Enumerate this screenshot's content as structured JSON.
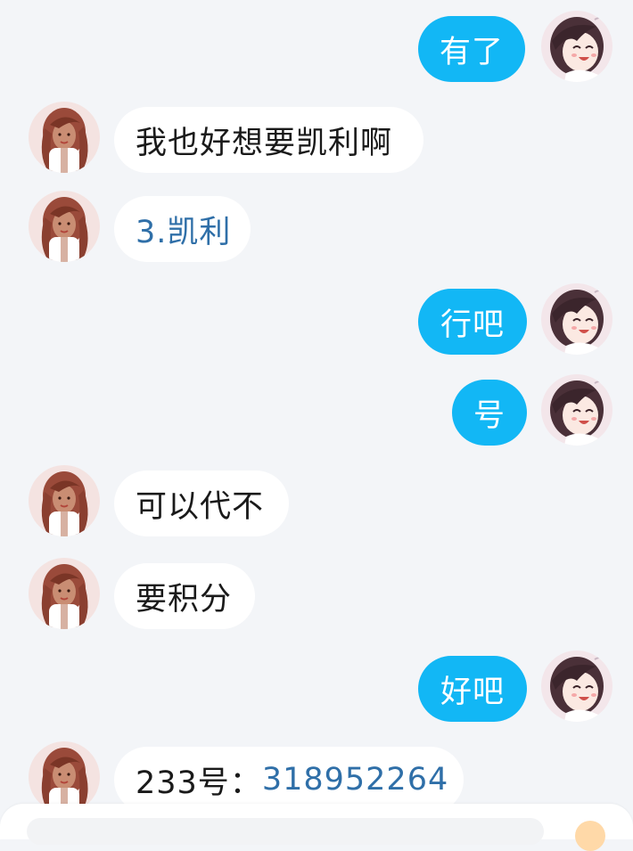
{
  "messages": [
    {
      "side": "out",
      "text": "有了"
    },
    {
      "side": "in",
      "text": "我也好想要凯利啊"
    },
    {
      "side": "in",
      "text": "3.凯利"
    },
    {
      "side": "out",
      "text": "行吧"
    },
    {
      "side": "out",
      "text": "号"
    },
    {
      "side": "in",
      "text": "可以代不"
    },
    {
      "side": "in",
      "text": "要积分"
    },
    {
      "side": "out",
      "text": "好吧"
    },
    {
      "side": "in",
      "prefix": "233号：",
      "link": "318952264"
    }
  ],
  "colors": {
    "outgoing_bubble": "#12b7f5",
    "incoming_bubble": "#ffffff",
    "link": "#2f6fa8",
    "background": "#f3f5f8"
  },
  "icons": {
    "incoming_avatar": "anime-girl-brown-hair-avatar",
    "outgoing_avatar": "anime-girl-smiling-avatar"
  }
}
